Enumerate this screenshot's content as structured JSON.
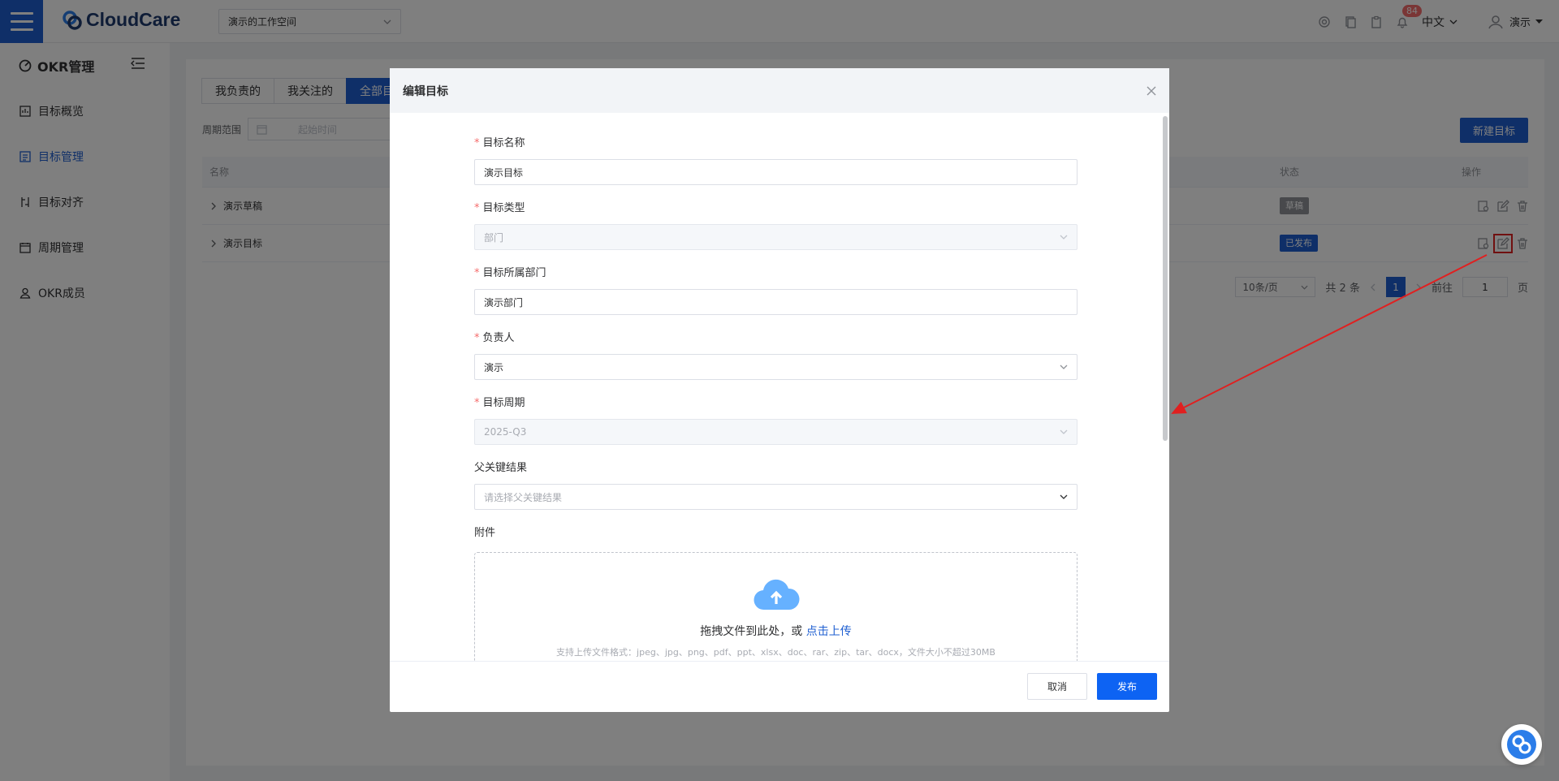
{
  "brand": {
    "logo_text": "CloudCare"
  },
  "header": {
    "workspace": "演示的工作空间",
    "notification_count": "84",
    "language": "中文",
    "user_name": "演示"
  },
  "sidebar": {
    "title": "OKR管理",
    "items": [
      {
        "label": "目标概览",
        "icon": "overview-icon",
        "active": false
      },
      {
        "label": "目标管理",
        "icon": "list-icon",
        "active": true
      },
      {
        "label": "目标对齐",
        "icon": "align-icon",
        "active": false
      },
      {
        "label": "周期管理",
        "icon": "calendar-icon",
        "active": false
      },
      {
        "label": "OKR成员",
        "icon": "user-icon",
        "active": false
      }
    ]
  },
  "main": {
    "tabs": [
      {
        "label": "我负责的",
        "active": false
      },
      {
        "label": "我关注的",
        "active": false
      },
      {
        "label": "全部目",
        "active": true
      }
    ],
    "period_label": "周期范围",
    "period_placeholder": "起始时间",
    "new_button": "新建目标",
    "table": {
      "columns": [
        "名称",
        "状态",
        "操作"
      ],
      "rows": [
        {
          "name": "演示草稿",
          "status": "草稿",
          "status_color": "#909399"
        },
        {
          "name": "演示目标",
          "status": "已发布",
          "status_color": "#1f5fd1"
        }
      ]
    },
    "pagination": {
      "page_size": "10条/页",
      "total": "共 2 条",
      "current": "1",
      "goto_label": "前往",
      "goto_value": "1",
      "page_unit": "页"
    }
  },
  "dialog": {
    "title": "编辑目标",
    "fields": {
      "name": {
        "label": "目标名称",
        "value": "演示目标"
      },
      "type": {
        "label": "目标类型",
        "value": "部门"
      },
      "dept": {
        "label": "目标所属部门",
        "value": "演示部门"
      },
      "owner": {
        "label": "负责人",
        "value": "演示"
      },
      "period": {
        "label": "目标周期",
        "value": "2025-Q3"
      },
      "parent_kr": {
        "label": "父关键结果",
        "placeholder": "请选择父关键结果"
      },
      "attachment": {
        "label": "附件"
      }
    },
    "upload": {
      "text": "拖拽文件到此处，或",
      "link": "点击上传",
      "tip": "支持上传文件格式：jpeg、jpg、png、pdf、ppt、xlsx、doc、rar、zip、tar、docx，文件大小不超过30MB"
    },
    "cancel": "取消",
    "publish": "发布"
  },
  "colors": {
    "primary": "#1f5fd1",
    "publish": "#0d63f3",
    "danger": "#f56c6c",
    "annotation": "#e02020"
  }
}
